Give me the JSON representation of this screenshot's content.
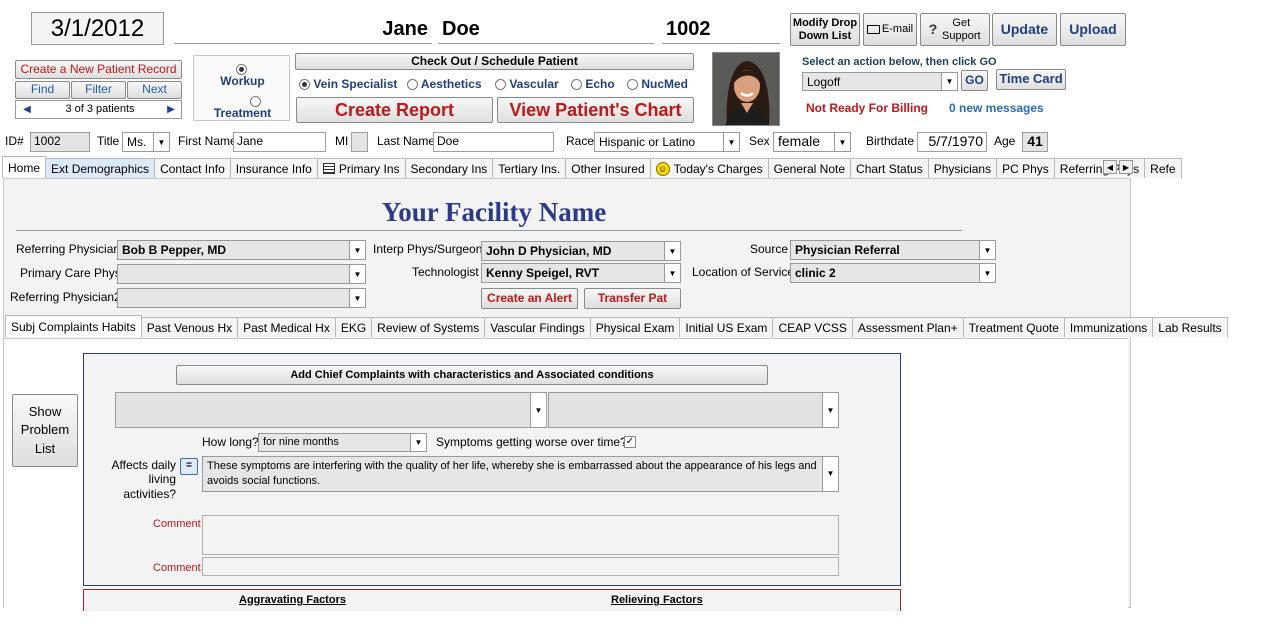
{
  "header": {
    "date": "3/1/2012",
    "first_name": "Jane",
    "last_name": "Doe",
    "patient_id": "1002",
    "modify_drop_label": "Modify Drop Down List",
    "email_label": "E-mail",
    "support_label": "Get Support",
    "update_label": "Update",
    "upload_label": "Upload"
  },
  "nav": {
    "new_record_label": "Create a New Patient Record",
    "find_label": "Find",
    "filter_label": "Filter",
    "next_label": "Next",
    "record_counter": "3 of  3 patients"
  },
  "mode": {
    "workup_label": "Workup",
    "treatment_label": "Treatment",
    "selected": "Workup"
  },
  "checkout": {
    "label": "Check Out / Schedule Patient",
    "options": [
      {
        "label": "Vein Specialist",
        "on": true
      },
      {
        "label": "Aesthetics",
        "on": false
      },
      {
        "label": "Vascular",
        "on": false
      },
      {
        "label": "Echo",
        "on": false
      },
      {
        "label": "NucMed",
        "on": false
      }
    ],
    "create_report_label": "Create Report",
    "view_chart_label": "View Patient's Chart"
  },
  "actions": {
    "prompt": "Select an action below, then click GO",
    "selected": "Logoff",
    "go_label": "GO",
    "timecard_label": "Time Card",
    "billing_status": "Not Ready For Billing",
    "messages": "0 new messages"
  },
  "demographics": {
    "id_label": "ID#",
    "id": "1002",
    "title_label": "Title",
    "title": "Ms.",
    "first_label": "First Name",
    "first": "Jane",
    "mi_label": "MI",
    "mi": "",
    "last_label": "Last Name",
    "last": "Doe",
    "race_label": "Race",
    "race": "Hispanic or Latino",
    "sex_label": "Sex",
    "sex": "female",
    "birth_label": "Birthdate",
    "birthdate": "5/7/1970",
    "age_label": "Age",
    "age": "41"
  },
  "main_tabs": [
    {
      "label": "Home",
      "active": true
    },
    {
      "label": "Ext Demographics"
    },
    {
      "label": "Contact Info"
    },
    {
      "label": "Insurance Info"
    },
    {
      "label": "Primary Ins",
      "icon": "card-icon"
    },
    {
      "label": "Secondary Ins"
    },
    {
      "label": "Tertiary Ins."
    },
    {
      "label": "Other Insured"
    },
    {
      "label": "Today's Charges",
      "icon": "smiley-icon"
    },
    {
      "label": "General Note"
    },
    {
      "label": "Chart Status"
    },
    {
      "label": "Physicians"
    },
    {
      "label": "PC Phys"
    },
    {
      "label": "Referring Phys"
    },
    {
      "label": "Refe"
    }
  ],
  "facility": {
    "name": "Your Facility Name"
  },
  "physicians": {
    "ref_label": "Referring Physician",
    "ref": "Bob B Pepper, MD",
    "pcp_label": "Primary Care Phys",
    "pcp": "",
    "ref2_label": "Referring Physician2",
    "ref2": "",
    "interp_label": "Interp Phys/Surgeon",
    "interp": "John D Physician, MD",
    "tech_label": "Technologist",
    "tech": "Kenny Speigel, RVT",
    "source_label": "Source",
    "source": "Physician Referral",
    "loc_label": "Location of Service",
    "loc": "clinic 2",
    "alert_label": "Create an Alert",
    "transfer_label": "Transfer Pat"
  },
  "sub_tabs": [
    {
      "label": "Subj Complaints Habits",
      "active": true
    },
    {
      "label": "Past Venous Hx"
    },
    {
      "label": "Past Medical Hx"
    },
    {
      "label": "EKG"
    },
    {
      "label": "Review of Systems"
    },
    {
      "label": "Vascular Findings"
    },
    {
      "label": "Physical Exam"
    },
    {
      "label": "Initial US Exam"
    },
    {
      "label": "CEAP VCSS"
    },
    {
      "label": "Assessment Plan+"
    },
    {
      "label": "Treatment Quote"
    },
    {
      "label": "Immunizations"
    },
    {
      "label": "Lab Results"
    }
  ],
  "complaints": {
    "problem_list_label": "Show Problem List",
    "add_label": "Add Chief Complaints with characteristics and Associated conditions",
    "how_long_label": "How long?",
    "how_long": "for nine months",
    "worse_label": "Symptoms getting worse over time?",
    "affects_label": "Affects daily living activities?",
    "affects_text": "These symptoms are interfering with the quality of her life, whereby she is embarrassed about the appearance of his legs and avoids social functions.",
    "comment_label": "Comment",
    "aggravating_label": "Aggravating Factors",
    "relieving_label": "Relieving Factors"
  }
}
